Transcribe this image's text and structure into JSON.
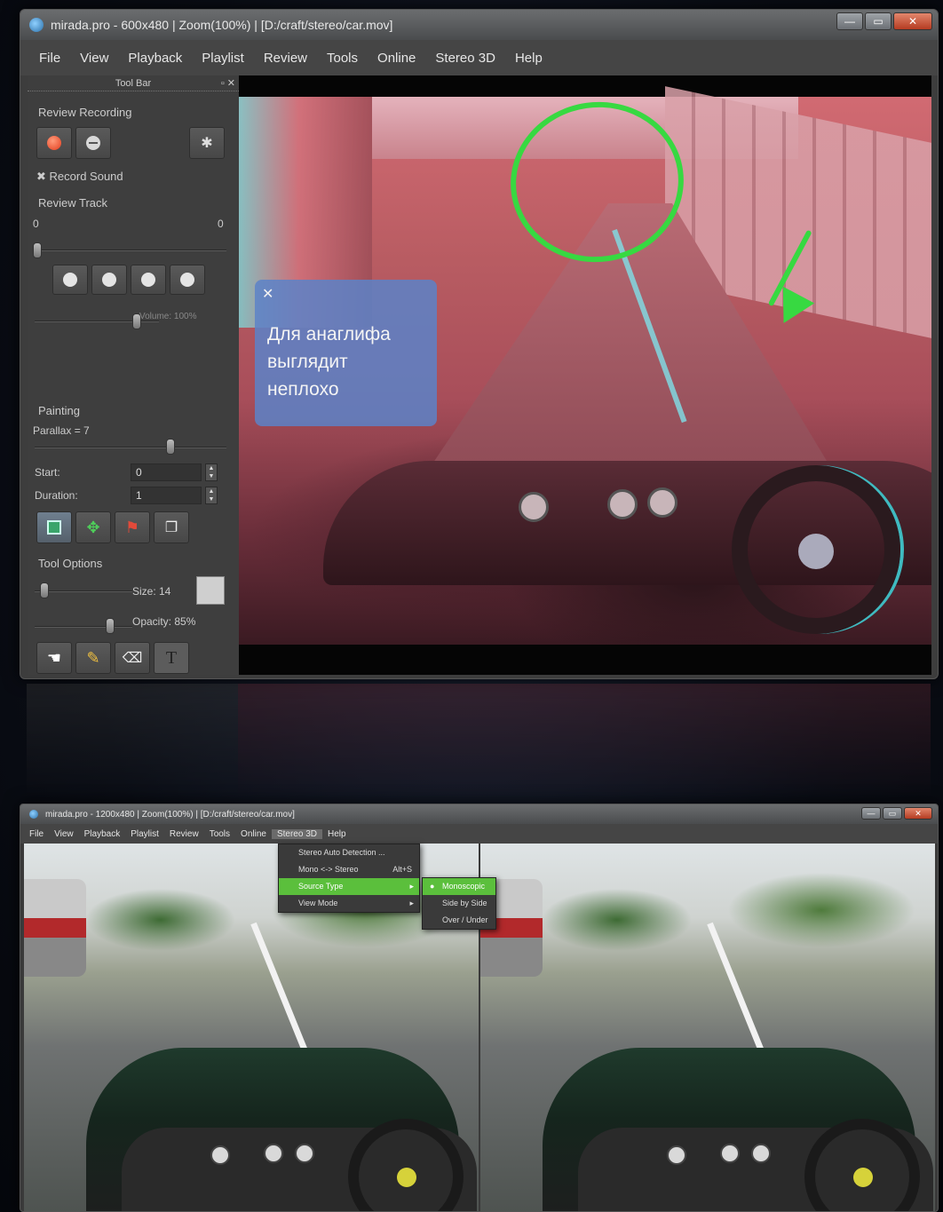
{
  "window1": {
    "title": "mirada.pro - 600x480 | Zoom(100%) | [D:/craft/stereo/car.mov]",
    "window_controls": {
      "minimize": "—",
      "maximize": "▭",
      "close": "✕"
    },
    "menu": [
      "File",
      "View",
      "Playback",
      "Playlist",
      "Review",
      "Tools",
      "Online",
      "Stereo 3D",
      "Help"
    ],
    "toolbar_title": "Tool Bar",
    "review_recording": {
      "label": "Review Recording",
      "record_sound": "Record Sound",
      "record_sound_checked": true
    },
    "review_track": {
      "label": "Review Track",
      "min": "0",
      "max": "0",
      "volume_label": "Volume: 100%"
    },
    "painting": {
      "label": "Painting",
      "parallax_label": "Parallax = 7",
      "start_label": "Start:",
      "start_value": "0",
      "duration_label": "Duration:",
      "duration_value": "1"
    },
    "tool_options": {
      "label": "Tool Options",
      "size_label": "Size: 14",
      "opacity_label": "Opacity: 85%"
    },
    "annotation": {
      "close_glyph": "✕",
      "text": "Для анаглифа\nвыглядит\nнеплохо",
      "box_color": "#5c82c8"
    },
    "markup_color": "#37d941"
  },
  "window2": {
    "title": "mirada.pro - 1200x480 | Zoom(100%) | [D:/craft/stereo/car.mov]",
    "menu": [
      "File",
      "View",
      "Playback",
      "Playlist",
      "Review",
      "Tools",
      "Online",
      "Stereo 3D",
      "Help"
    ],
    "active_menu": "Stereo 3D",
    "stereo_menu": [
      {
        "label": "Stereo Auto Detection ...",
        "shortcut": ""
      },
      {
        "label": "Mono <-> Stereo",
        "shortcut": "Alt+S"
      },
      {
        "label": "Source Type",
        "shortcut": "",
        "submenu": true,
        "highlighted": true
      },
      {
        "label": "View Mode",
        "shortcut": "",
        "submenu": true
      }
    ],
    "source_type_submenu": [
      {
        "label": "Monoscopic",
        "selected": true,
        "highlighted": true
      },
      {
        "label": "Side by Side",
        "selected": false
      },
      {
        "label": "Over / Under",
        "selected": false
      }
    ],
    "highlight_color": "#5bbf3c"
  }
}
